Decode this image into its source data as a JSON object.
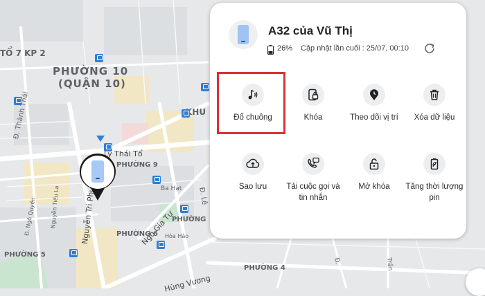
{
  "map": {
    "labels": {
      "to7kp2": "TỔ 7 KP 2",
      "phuong10": "PHƯỜNG 10",
      "quan10": "(QUẬN 10)",
      "khu": "KHU",
      "ly_thai_to": "Lý Thái Tổ",
      "phuong9": "PHƯỜNG 9",
      "ba_hat": "Ba Hạt",
      "duong_thanh_thai": "Đ. Thành Thái",
      "nguyen_tieu_la": "Nguyễn Tiểu La",
      "ngo_quyen": "Đ. Ngô Quyền",
      "nguyen_tri_phuong": "Nguyễn Tri Phương",
      "ngo_gia_tu": "Ngô Gia Tự",
      "phuong_right": "PHƯỜNG",
      "phuong6": "PHƯỜNG 6",
      "phuong5": "PHƯỜNG 5",
      "phuong4": "PHƯỜNG 4",
      "hoa_hao": "Hòa Hảo",
      "hung_vuong": "Hùng Vương",
      "le": "Đ. Lê",
      "d_right": "Đ.",
      "tran": "Trần"
    }
  },
  "device": {
    "name": "A32 của Vũ Thị",
    "battery": "26%",
    "updated": "Cập nhật lần cuối : 25/07, 00:10"
  },
  "actions": {
    "ring": "Đổ chuông",
    "lock": "Khóa",
    "track": "Theo dõi vị trí",
    "erase": "Xóa dữ liệu",
    "backup": "Sao lưu",
    "retrieve": "Tải cuộc gọi và tin nhắn",
    "unlock": "Mở khóa",
    "extend": "Tăng thời lượng pin"
  },
  "colors": {
    "highlight": "#d93237",
    "accent_blue": "#2f7fd4",
    "phone_screen": "#9fc3f2"
  }
}
